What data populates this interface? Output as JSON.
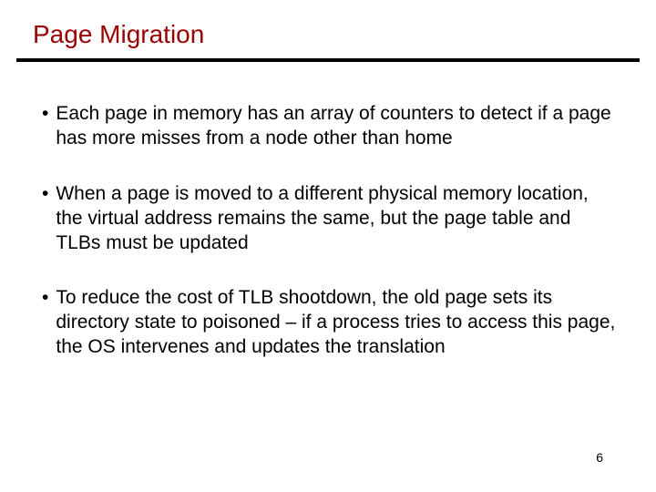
{
  "title": "Page Migration",
  "bullets": [
    {
      "text": "Each page in memory has an array of counters to detect if a page has more misses from a node other than home"
    },
    {
      "text": "When a page is moved to a different physical memory location, the virtual address remains the same, but the page table and TLBs must be updated"
    },
    {
      "text": "To reduce the cost of TLB shootdown, the old page sets its directory state to poisoned – if a process tries to access this page, the OS intervenes and updates the translation"
    }
  ],
  "page_number": "6",
  "bullet_marker": "•"
}
